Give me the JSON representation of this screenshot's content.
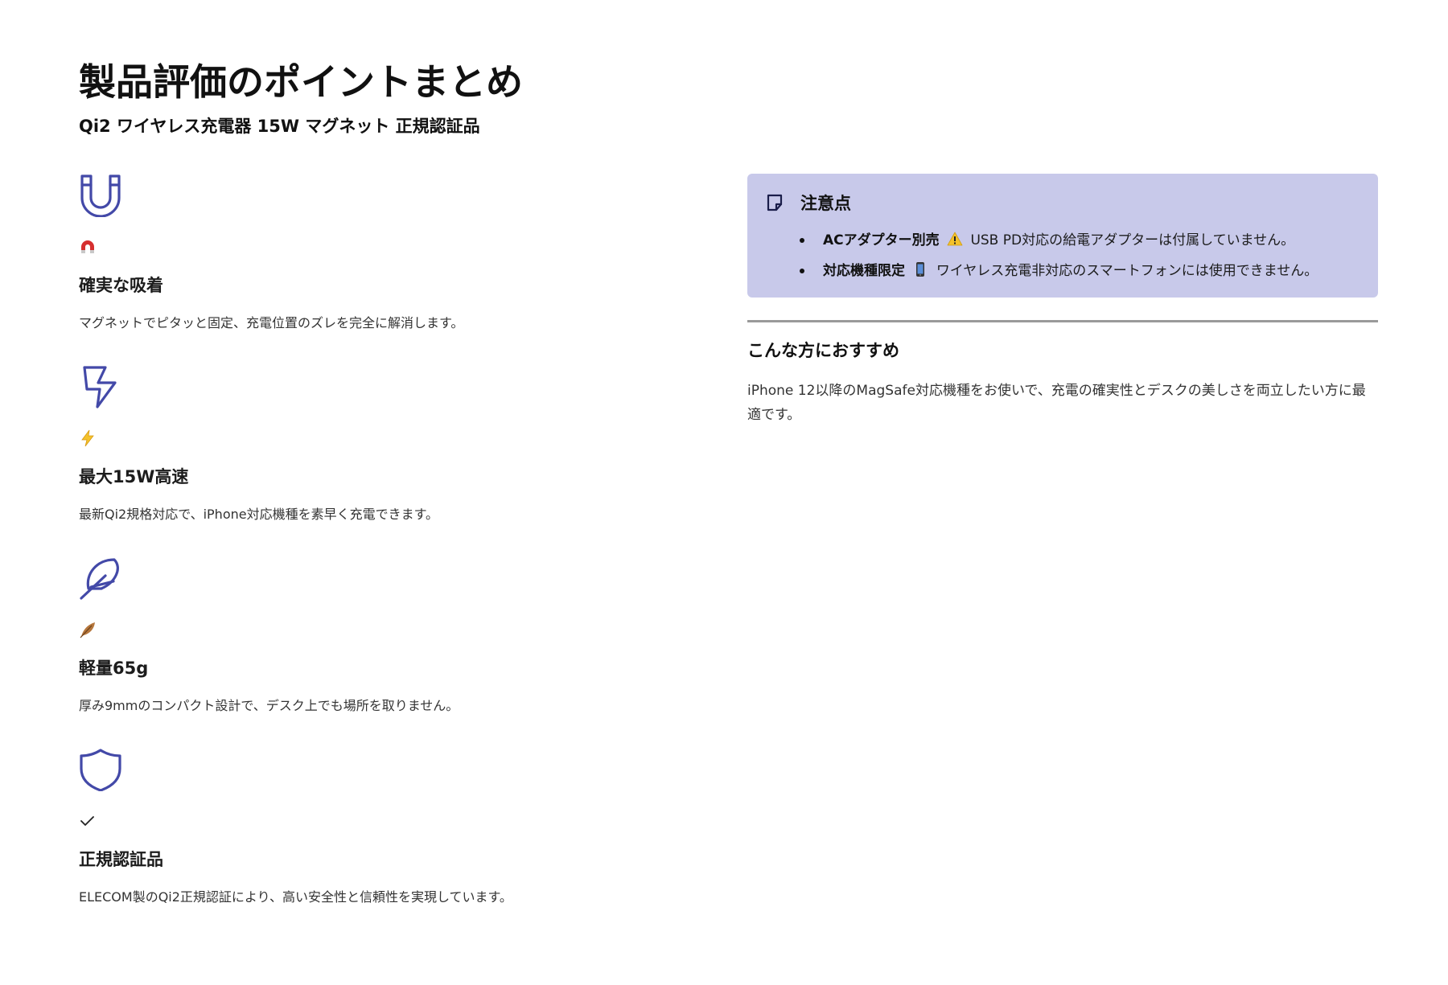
{
  "header": {
    "title": "製品評価のポイントまとめ",
    "subtitle": "Qi2 ワイヤレス充電器 15W マグネット 正規認証品"
  },
  "colors": {
    "icon_stroke": "#4349a8",
    "callout_bg": "#c8c9ea",
    "divider": "#9a9a9a"
  },
  "features": [
    {
      "icon": "magnet-icon",
      "emoji": "magnet-emoji",
      "title": "確実な吸着",
      "description": "マグネットでピタッと固定、充電位置のズレを完全に解消します。"
    },
    {
      "icon": "lightning-icon",
      "emoji": "high-voltage-emoji",
      "title": "最大15W高速",
      "description": "最新Qi2規格対応で、iPhone対応機種を素早く充電できます。"
    },
    {
      "icon": "feather-icon",
      "emoji": "feather-emoji",
      "title": "軽量65g",
      "description": "厚み9mmのコンパクト設計で、デスク上でも場所を取りません。"
    },
    {
      "icon": "shield-icon",
      "emoji": "check-mark-emoji",
      "title": "正規認証品",
      "description": "ELECOM製のQi2正規認証により、高い安全性と信頼性を実現しています。"
    }
  ],
  "callout": {
    "icon": "note-icon",
    "title": "注意点",
    "items": [
      {
        "label": "ACアダプター別売",
        "emoji": "warning-emoji",
        "text": "USB PD対応の給電アダプターは付属していません。"
      },
      {
        "label": "対応機種限定",
        "emoji": "mobile-phone-emoji",
        "text": "ワイヤレス充電非対応のスマートフォンには使用できません。"
      }
    ]
  },
  "recommend": {
    "title": "こんな方におすすめ",
    "text": "iPhone 12以降のMagSafe対応機種をお使いで、充電の確実性とデスクの美しさを両立したい方に最適です。"
  }
}
